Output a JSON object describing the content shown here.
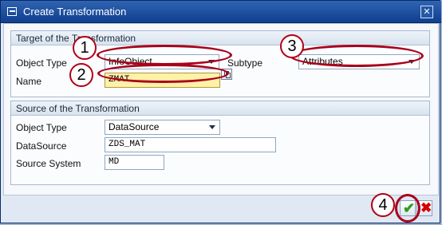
{
  "window": {
    "title": "Create Transformation",
    "close_glyph": "✕"
  },
  "target": {
    "group_title": "Target of the Transformation",
    "object_type_label": "Object Type",
    "object_type_value": "InfoObject",
    "subtype_label": "Subtype",
    "subtype_value": "Attributes",
    "name_label": "Name",
    "name_value": "ZMAT"
  },
  "source": {
    "group_title": "Source of the Transformation",
    "object_type_label": "Object Type",
    "object_type_value": "DataSource",
    "datasource_label": "DataSource",
    "datasource_value": "ZDS_MAT",
    "source_system_label": "Source System",
    "source_system_value": "MD"
  },
  "footer": {
    "ok_glyph": "✔",
    "cancel_glyph": "✖"
  },
  "annotations": [
    "1",
    "2",
    "3",
    "4"
  ],
  "colors": {
    "title_bar": "#0f3f8f",
    "highlight_ring": "#a8001a",
    "name_field_bg": "#fff1a8"
  },
  "icons": [
    "create-icon",
    "close-icon",
    "value-help-icon",
    "confirm-icon",
    "cancel-icon",
    "dropdown-arrow-icon"
  ]
}
